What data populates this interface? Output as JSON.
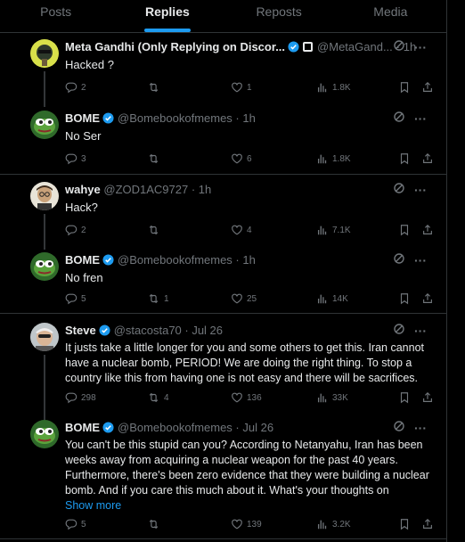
{
  "tabs": [
    {
      "label": "Posts"
    },
    {
      "label": "Replies"
    },
    {
      "label": "Reposts"
    },
    {
      "label": "Media"
    }
  ],
  "colors": {
    "accent": "#1d9bf0",
    "text": "#e7e9ea",
    "muted": "#71767b",
    "border": "#2f3336",
    "verified": "#1d9bf0"
  },
  "tweets": [
    {
      "name": "Meta Gandhi (Only Replying on Discor...",
      "handle": "@MetaGand...",
      "time": "· 1h",
      "text": "Hacked ?",
      "replies": "2",
      "reposts": "",
      "likes": "1",
      "views": "1.8K"
    },
    {
      "name": "BOME",
      "handle": "@Bomebookofmemes · 1h",
      "time": "",
      "text": "No Ser",
      "replies": "3",
      "reposts": "",
      "likes": "6",
      "views": "1.8K"
    },
    {
      "name": "wahye",
      "handle": "@ZOD1AC9727 · 1h",
      "time": "",
      "text": "Hack?",
      "replies": "2",
      "reposts": "",
      "likes": "4",
      "views": "7.1K"
    },
    {
      "name": "BOME",
      "handle": "@Bomebookofmemes · 1h",
      "time": "",
      "text": "No fren",
      "replies": "5",
      "reposts": "1",
      "likes": "25",
      "views": "14K"
    },
    {
      "name": "Steve",
      "handle": "@stacosta70 · Jul 26",
      "time": "",
      "text": "It justs take a little longer for you and some others to get this. Iran cannot have a nuclear bomb, PERIOD! We are doing the right thing. To stop a country like this from having one is not easy and there will be sacrifices.",
      "replies": "298",
      "reposts": "4",
      "likes": "136",
      "views": "33K"
    },
    {
      "name": "BOME",
      "handle": "@Bomebookofmemes · Jul 26",
      "time": "",
      "text": "You can't be this stupid can you? According to Netanyahu, Iran has been weeks away from acquiring a nuclear weapon for the past 40 years. Furthermore, there's been zero evidence that they were building a nuclear bomb. And if you care this much about it. What's your thoughts on",
      "show_more": "Show more",
      "replies": "5",
      "reposts": "",
      "likes": "139",
      "views": "3.2K"
    }
  ]
}
